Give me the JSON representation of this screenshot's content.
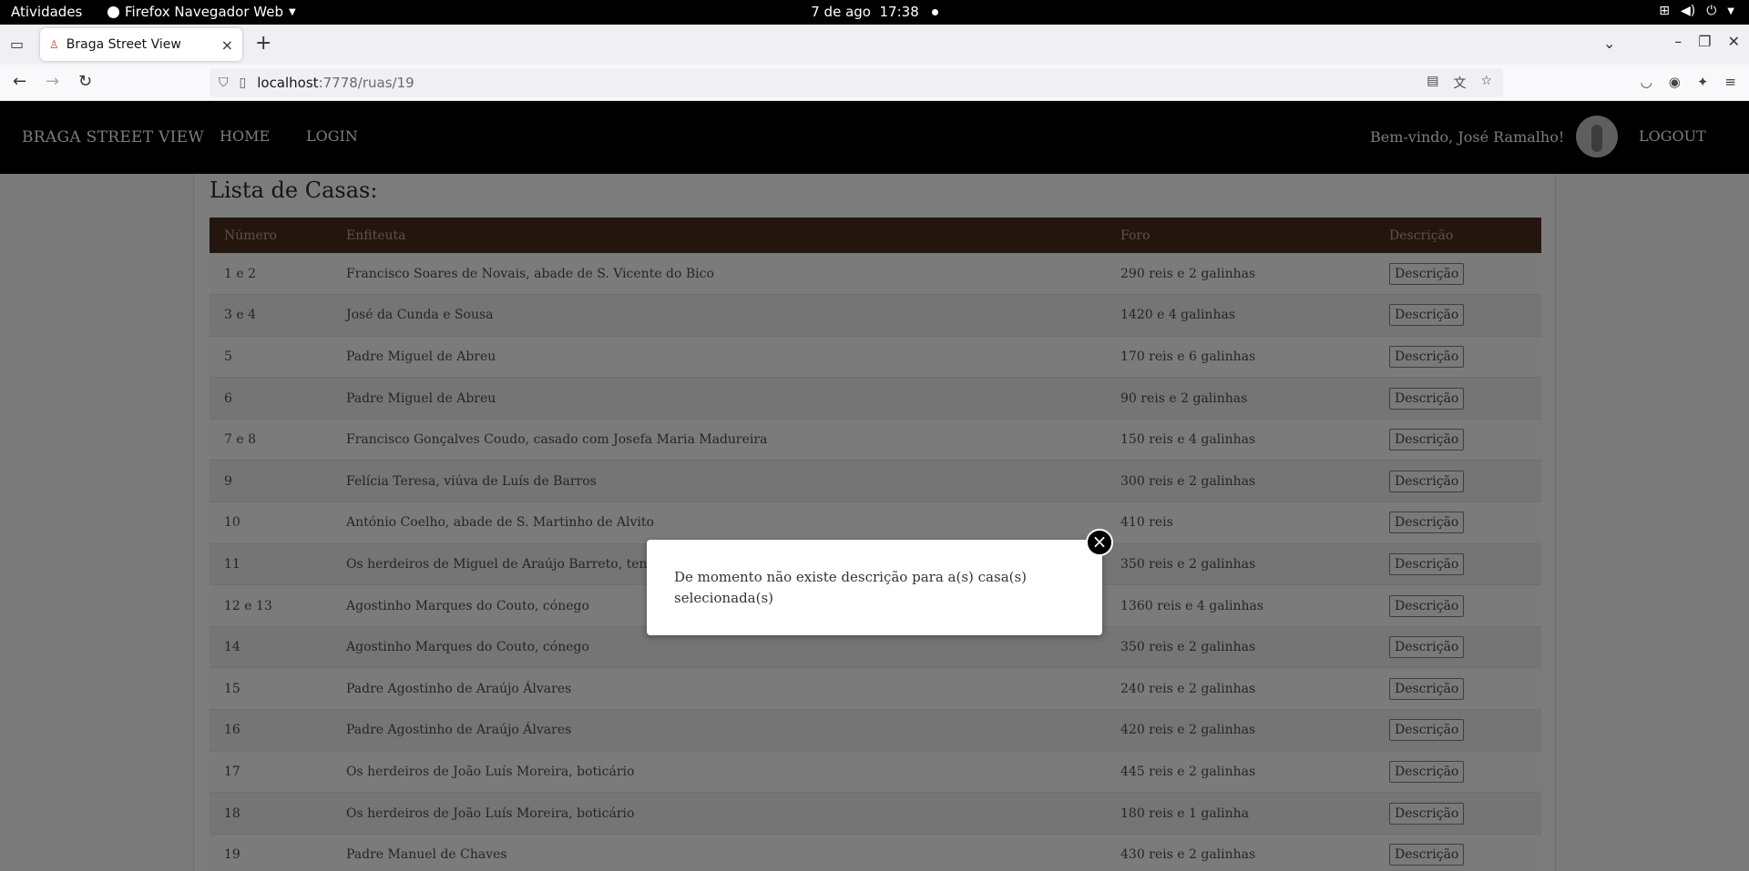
{
  "system": {
    "activities": "Atividades",
    "app_name": "Firefox Navegador Web",
    "date": "7 de ago",
    "time": "17:38"
  },
  "browser": {
    "tab_title": "Braga Street View",
    "url_host": "localhost",
    "url_path": ":7778/ruas/19"
  },
  "site": {
    "brand": "BRAGA STREET VIEW",
    "nav_home": "HOME",
    "nav_login": "LOGIN",
    "welcome": "Bem-vindo, José Ramalho!",
    "logout": "LOGOUT"
  },
  "main": {
    "heading": "Lista de Casas:",
    "columns": [
      "Número",
      "Enfiteuta",
      "Foro",
      "Descrição"
    ],
    "button_label": "Descrição",
    "rows": [
      {
        "numero": "1 e 2",
        "enfiteuta": "Francisco Soares de Novais, abade de S. Vicente do Bico",
        "foro": "290 reis e 2 galinhas"
      },
      {
        "numero": "3 e 4",
        "enfiteuta": "José da Cunda e Sousa",
        "foro": "1420 e 4 galinhas"
      },
      {
        "numero": "5",
        "enfiteuta": "Padre Miguel de Abreu",
        "foro": "170 reis e 6 galinhas"
      },
      {
        "numero": "6",
        "enfiteuta": "Padre Miguel de Abreu",
        "foro": "90 reis e 2 galinhas"
      },
      {
        "numero": "7 e 8",
        "enfiteuta": "Francisco Gonçalves Coudo, casado com Josefa Maria Madureira",
        "foro": "150 reis e 4 galinhas"
      },
      {
        "numero": "9",
        "enfiteuta": "Felícia Teresa, viúva de Luís de Barros",
        "foro": "300 reis e 2 galinhas"
      },
      {
        "numero": "10",
        "enfiteuta": "António Coelho, abade de S. Martinho de Alvito",
        "foro": "410 reis"
      },
      {
        "numero": "11",
        "enfiteuta": "Os herdeiros de Miguel de Araújo Barreto, tenente",
        "foro": "350 reis e 2 galinhas"
      },
      {
        "numero": "12 e 13",
        "enfiteuta": "Agostinho Marques do Couto, cónego",
        "foro": "1360 reis e 4 galinhas"
      },
      {
        "numero": "14",
        "enfiteuta": "Agostinho Marques do Couto, cónego",
        "foro": "350 reis e 2 galinhas"
      },
      {
        "numero": "15",
        "enfiteuta": "Padre Agostinho de Araújo Álvares",
        "foro": "240 reis e 2 galinhas"
      },
      {
        "numero": "16",
        "enfiteuta": "Padre Agostinho de Araújo Álvares",
        "foro": "420 reis e 2 galinhas"
      },
      {
        "numero": "17",
        "enfiteuta": "Os herdeiros de João Luís Moreira, boticário",
        "foro": "445 reis e 2 galinhas"
      },
      {
        "numero": "18",
        "enfiteuta": "Os herdeiros de João Luís Moreira, boticário",
        "foro": "180 reis e 1 galinha"
      },
      {
        "numero": "19",
        "enfiteuta": "Padre Manuel de Chaves",
        "foro": "430 reis e 2 galinhas"
      }
    ]
  },
  "modal": {
    "message": "De momento não existe descrição para a(s) casa(s) selecionada(s)",
    "close_symbol": "×"
  },
  "icons": {
    "back": "←",
    "forward": "→",
    "reload": "↻",
    "new_tab": "+",
    "tab_close": "×",
    "minimize": "–",
    "restore": "❐",
    "close": "✕",
    "tab_list": "⌄",
    "close_modal": "×"
  }
}
